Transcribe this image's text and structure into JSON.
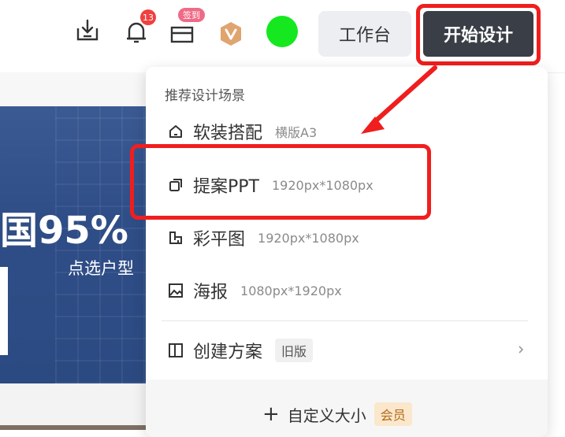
{
  "header": {
    "notification_count": "13",
    "checkin_label": "签到",
    "workbench_label": "工作台",
    "start_design_label": "开始设计"
  },
  "banner": {
    "title": "国95%",
    "subtitle": "点选户型"
  },
  "menu": {
    "heading": "推荐设计场景",
    "items": [
      {
        "name": "软装搭配",
        "size": "横版A3",
        "icon": "home-icon"
      },
      {
        "name": "提案PPT",
        "size": "1920px*1080px",
        "icon": "copy-icon"
      },
      {
        "name": "彩平图",
        "size": "1920px*1080px",
        "icon": "floorplan-icon"
      },
      {
        "name": "海报",
        "size": "1080px*1920px",
        "icon": "image-icon"
      }
    ],
    "create_plan_label": "创建方案",
    "old_version_tag": "旧版",
    "custom_size_label": "自定义大小",
    "member_tag": "会员"
  },
  "colors": {
    "accent_red": "#f01e1e",
    "start_button": "#3a3e46",
    "avatar": "#15e81f"
  }
}
